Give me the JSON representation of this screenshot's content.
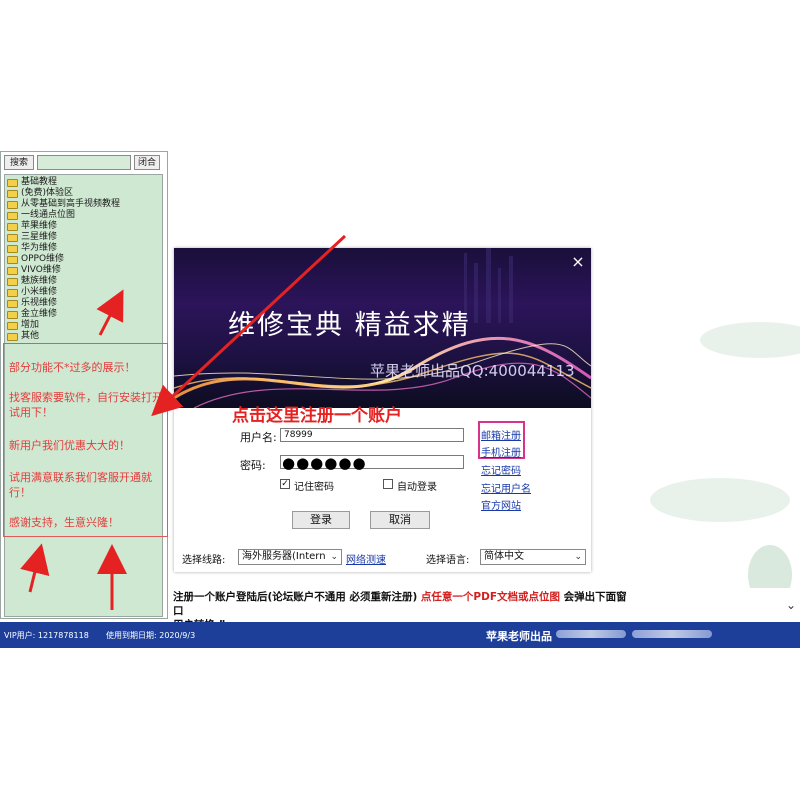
{
  "left_panel": {
    "search_button": "搜索",
    "close_button": "闭合",
    "tree_items": [
      "基础教程",
      "(免费)体验区",
      "从零基础到高手视频教程",
      "一线通点位图",
      "苹果维修",
      "三星维修",
      "华为维修",
      "OPPO维修",
      "VIVO维修",
      "魅族维修",
      "小米维修",
      "乐视维修",
      "金立维修",
      "增加",
      "其他"
    ],
    "promo_lines": [
      "部分功能不*过多的展示！",
      "找客服索要软件，自行安装打开试用下！",
      "新用户我们优惠大大的！",
      "试用满意联系我们客服开通就行！",
      "感谢支持，生意兴隆！"
    ]
  },
  "dialog": {
    "banner_title": "维修宝典  精益求精",
    "banner_subtitle": "苹果老师出品QQ:400044113",
    "close_glyph": "×",
    "red_tip": "点击这里注册一个账户",
    "username_label": "用户名:",
    "username_value": "78999",
    "password_label": "密码:",
    "password_value": "●●●●●●",
    "remember_password": "记住密码",
    "auto_login": "自动登录",
    "remember_checked": true,
    "auto_login_checked": false,
    "login_button": "登录",
    "cancel_button": "取消",
    "links": {
      "email_register": "邮箱注册",
      "phone_register": "手机注册",
      "forgot_password": "忘记密码",
      "forgot_username": "忘记用户名",
      "official_site": "官方网站"
    },
    "route_label": "选择线路:",
    "route_value": "海外服务器(Intern",
    "speed_test": "网络测速",
    "language_label": "选择语言:",
    "language_value": "简体中文"
  },
  "note": {
    "part1": "注册一个账户登陆后(论坛账户不通用 必须重新注册) ",
    "part2": "点任意一个PDF文档或点位图",
    "part3": " 会弹出下面窗口",
    "part4": "用户转换 ”"
  },
  "status_bar": {
    "vip_user": "VIP用户: 1217878118",
    "expiry": "使用到期日期: 2020/9/3",
    "brand": "苹果老师出品"
  },
  "colors": {
    "status_bar": "#1d3f9a",
    "tree_bg": "#cfe8d2",
    "promo_red": "#e43b3b",
    "tip_red": "#e52222",
    "link_blue": "#1a3aa8",
    "register_box": "#d8338c"
  }
}
